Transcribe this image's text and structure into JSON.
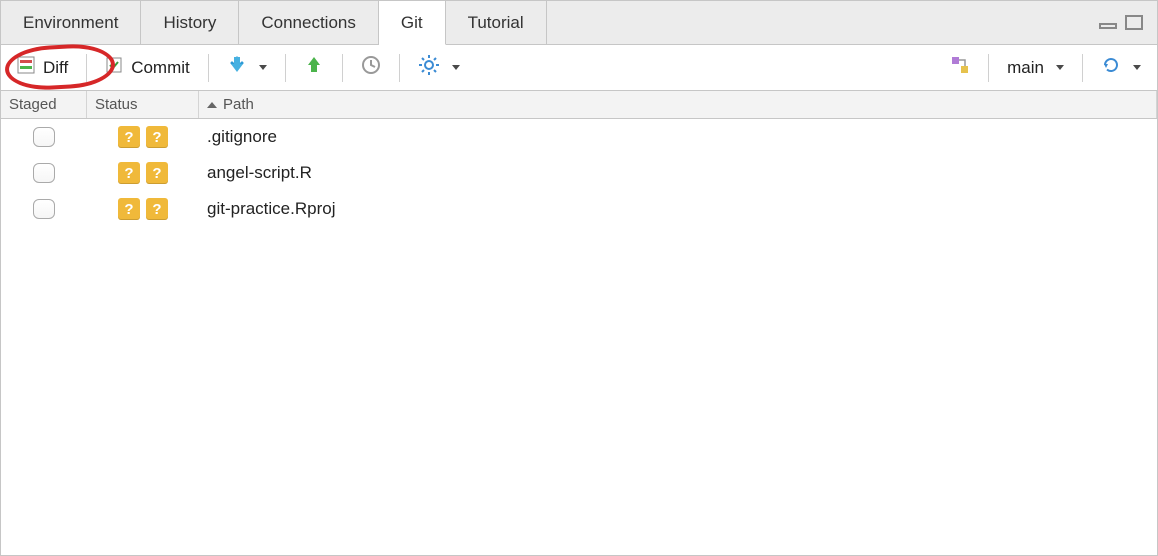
{
  "tabs": [
    {
      "label": "Environment",
      "active": false
    },
    {
      "label": "History",
      "active": false
    },
    {
      "label": "Connections",
      "active": false
    },
    {
      "label": "Git",
      "active": true
    },
    {
      "label": "Tutorial",
      "active": false
    }
  ],
  "toolbar": {
    "diff_label": "Diff",
    "commit_label": "Commit",
    "branch_label": "main"
  },
  "columns": {
    "staged": "Staged",
    "status": "Status",
    "path": "Path"
  },
  "files": [
    {
      "staged": false,
      "status": "??",
      "path": ".gitignore"
    },
    {
      "staged": false,
      "status": "??",
      "path": "angel-script.R"
    },
    {
      "staged": false,
      "status": "??",
      "path": "git-practice.Rproj"
    }
  ],
  "highlight": "diff"
}
